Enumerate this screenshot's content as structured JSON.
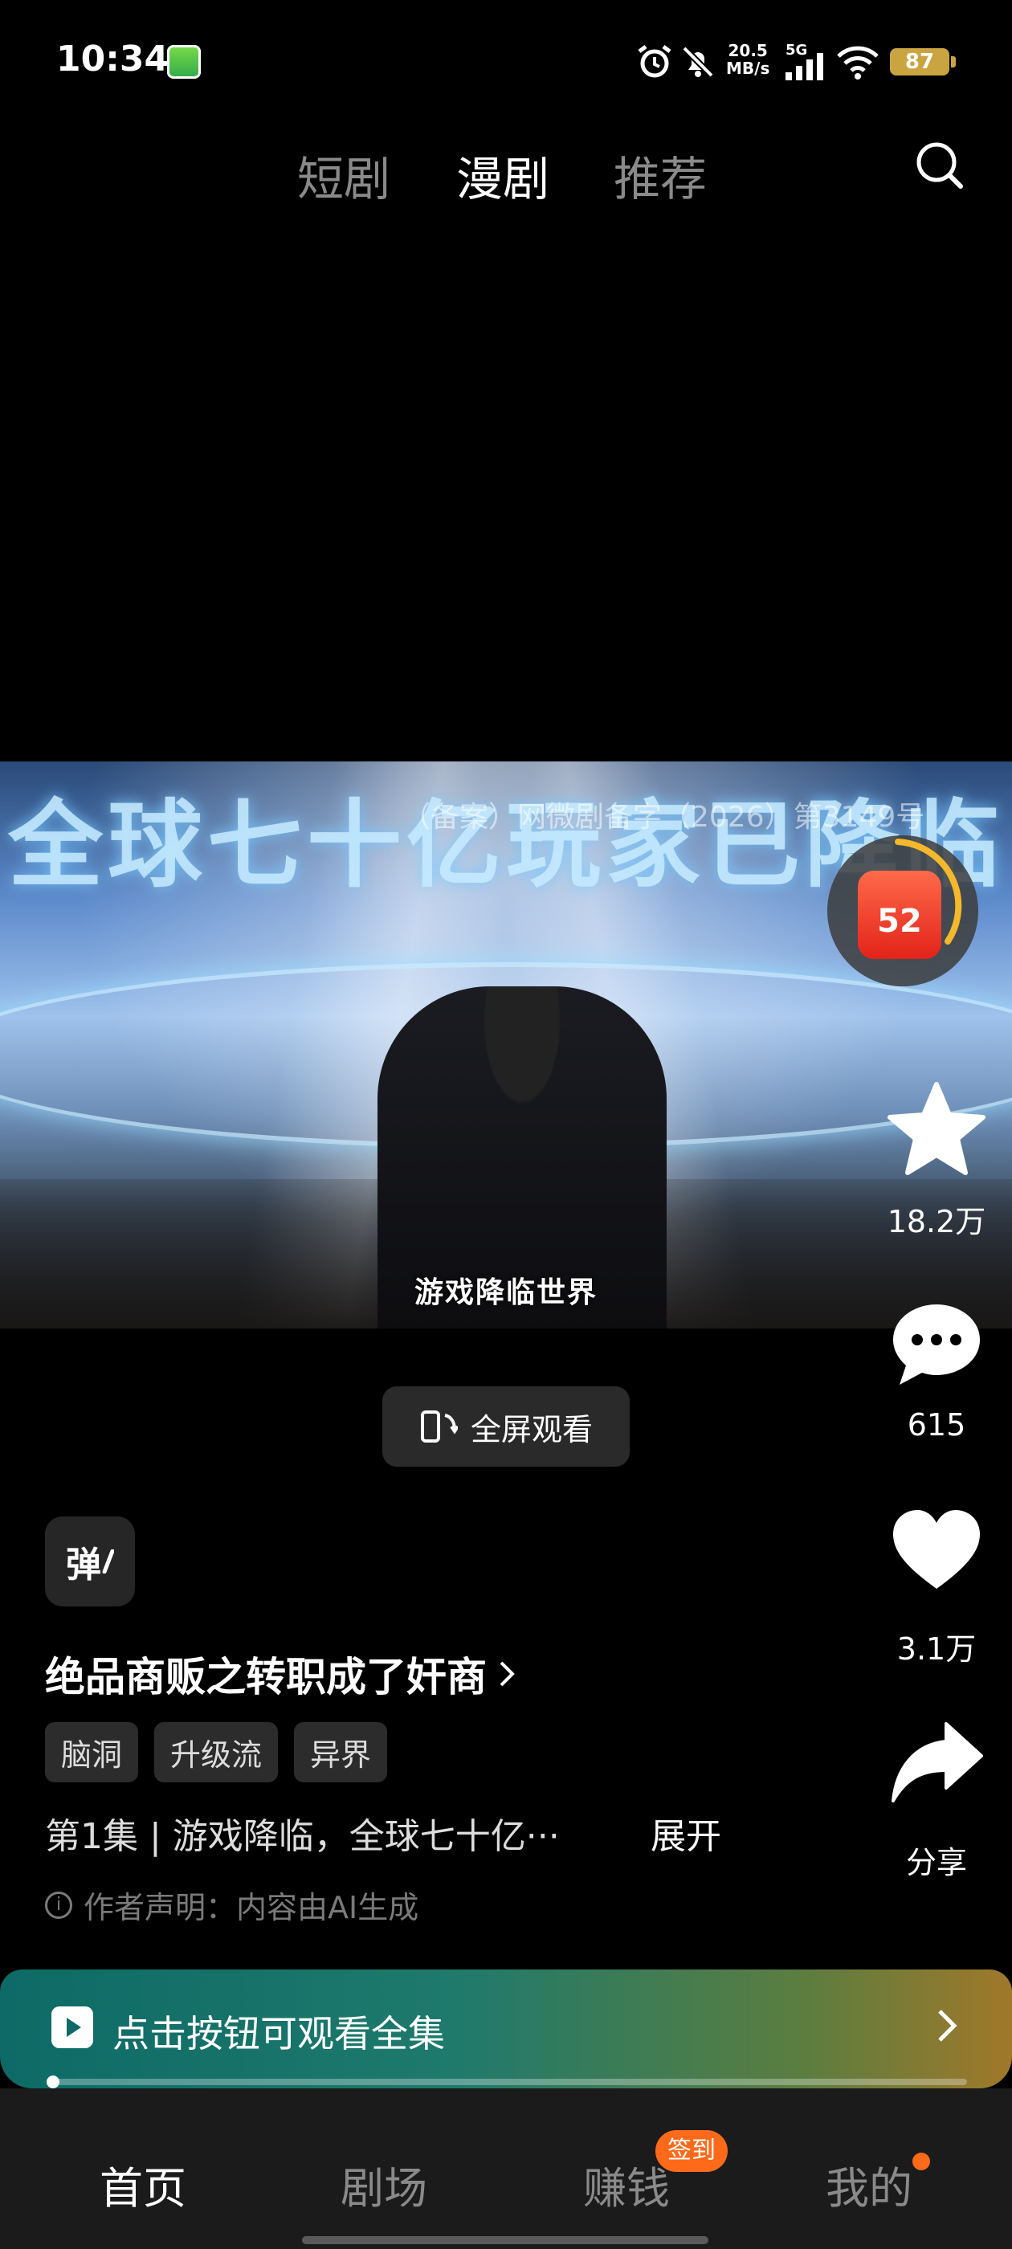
{
  "status_bar": {
    "time": "10:34",
    "net_speed_value": "20.5",
    "net_speed_unit": "MB/s",
    "network": "5G",
    "battery": "87"
  },
  "top_tabs": [
    {
      "label": "短剧",
      "active": false
    },
    {
      "label": "漫剧",
      "active": true
    },
    {
      "label": "推荐",
      "active": false
    }
  ],
  "video": {
    "title_overlay": "全球七十亿玩家已降临",
    "watermark": "（备案）网微剧备字（2026）第3149号",
    "subtitle": "游戏降临世界"
  },
  "reward": {
    "value": "52"
  },
  "actions": {
    "favorite_count": "18.2万",
    "comment_count": "615",
    "like_count": "3.1万",
    "share_label": "分享"
  },
  "fullscreen_label": "全屏观看",
  "danmaku_label": "弹",
  "drama": {
    "title": "绝品商贩之转职成了奸商",
    "tags": [
      "脑洞",
      "升级流",
      "异界"
    ],
    "description": "第1集 | 游戏降临，全球七十亿···",
    "expand_label": "展开",
    "ai_note": "作者声明：内容由AI生成"
  },
  "watch_banner": {
    "label": "点击按钮可观看全集",
    "progress": 0.005
  },
  "bottom_nav": {
    "items": [
      {
        "label": "首页",
        "active": true
      },
      {
        "label": "剧场",
        "active": false
      },
      {
        "label": "赚钱",
        "active": false
      },
      {
        "label": "我的",
        "active": false
      }
    ],
    "checkin_badge": "签到"
  },
  "colors": {
    "accent_orange": "#ff6a1a",
    "background": "#000000"
  }
}
